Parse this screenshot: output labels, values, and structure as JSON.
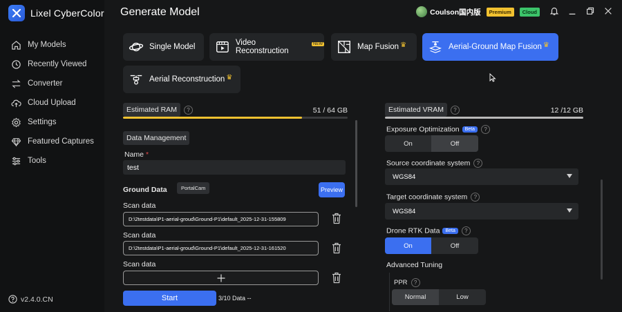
{
  "app": {
    "name": "Lixel CyberColor",
    "version": "v2.4.0.CN"
  },
  "sidebar": {
    "items": [
      {
        "label": "My Models",
        "icon": "home-icon"
      },
      {
        "label": "Recently Viewed",
        "icon": "clock-icon"
      },
      {
        "label": "Converter",
        "icon": "swap-icon"
      },
      {
        "label": "Cloud Upload",
        "icon": "cloud-upload-icon"
      },
      {
        "label": "Settings",
        "icon": "gear-icon"
      },
      {
        "label": "Featured Captures",
        "icon": "diamond-icon"
      },
      {
        "label": "Tools",
        "icon": "tools-icon"
      }
    ]
  },
  "header": {
    "title": "Generate Model",
    "user": "Coulson国内版",
    "premium_badge": "Premium",
    "cloud_badge": "Cloud"
  },
  "modes": [
    {
      "label": "Single Model",
      "active": false
    },
    {
      "label": "Video Reconstruction",
      "active": false
    },
    {
      "label": "Map Fusion",
      "active": false
    },
    {
      "label": "Aerial-Ground Map Fusion",
      "active": true
    },
    {
      "label": "Aerial Reconstruction",
      "active": false
    }
  ],
  "left": {
    "ram_label": "Estimated RAM",
    "ram_value": "51 / 64 GB",
    "ram_fraction": 0.797,
    "data_mgmt_label": "Data Management",
    "name_label": "Name",
    "name_required": "*",
    "name_value": "test",
    "ground_data_label": "Ground Data",
    "device_tag": "PortalCam",
    "preview_label": "Preview",
    "scan_label": "Scan data",
    "scans": [
      "D:\\2testdata\\P1-aerial-groud\\Ground-P1\\default_2025-12-31-155809",
      "D:\\2testdata\\P1-aerial-groud\\Ground-P1\\default_2025-12-31-161520"
    ],
    "start_label": "Start",
    "data_count": "3/10 Data --"
  },
  "right": {
    "vram_label": "Estimated VRAM",
    "vram_value": "12 /12 GB",
    "exposure_label": "Exposure Optimization",
    "beta": "Beta",
    "on": "On",
    "off": "Off",
    "source_cs_label": "Source coordinate system",
    "source_cs_value": "WGS84",
    "target_cs_label": "Target coordinate system",
    "target_cs_value": "WGS84",
    "rtk_label": "Drone RTK Data",
    "advanced_label": "Advanced Tuning",
    "ppr_label": "PPR",
    "normal": "Normal",
    "low": "Low"
  },
  "colors": {
    "accent": "#3b6ff0",
    "bg": "#161718",
    "ram_bar": "#f2c230"
  }
}
